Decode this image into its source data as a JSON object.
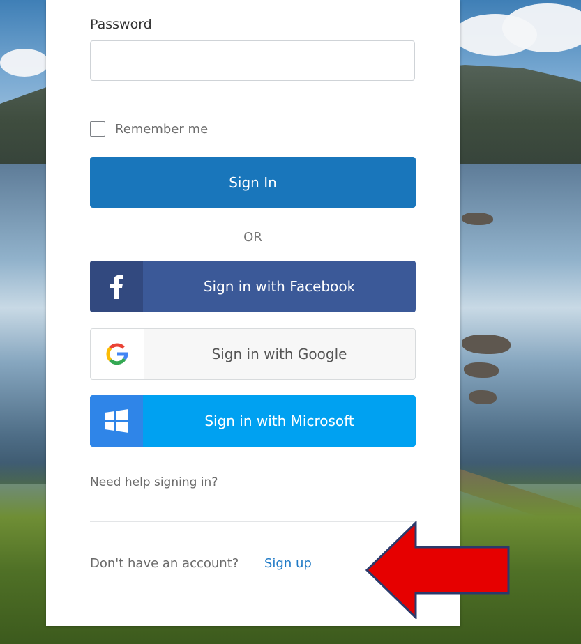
{
  "form": {
    "password_label": "Password",
    "password_value": "",
    "remember_label": "Remember me",
    "signin_label": "Sign In",
    "or_label": "OR",
    "facebook_label": "Sign in with Facebook",
    "google_label": "Sign in with Google",
    "microsoft_label": "Sign in with Microsoft",
    "help_label": "Need help signing in?",
    "no_account_text": "Don't have an account?",
    "signup_label": "Sign up"
  },
  "icons": {
    "facebook": "facebook-icon",
    "google": "google-icon",
    "microsoft": "windows-icon",
    "annotation": "red-arrow-icon"
  },
  "colors": {
    "primary": "#1976bb",
    "facebook": "#3b5998",
    "microsoft": "#00a1f1",
    "link": "#1f7ac6",
    "arrow": "#e60000"
  }
}
